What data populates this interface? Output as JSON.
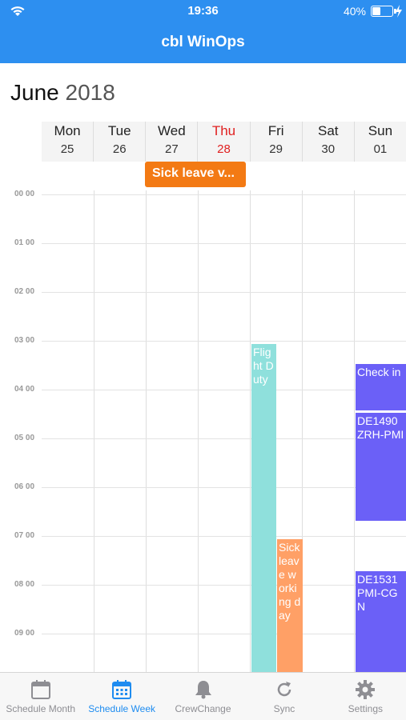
{
  "status_bar": {
    "time": "19:36",
    "battery": "40%"
  },
  "nav": {
    "title": "cbl WinOps"
  },
  "header": {
    "month": "June",
    "year": "2018"
  },
  "days": [
    {
      "name": "Mon",
      "date": "25",
      "today": false
    },
    {
      "name": "Tue",
      "date": "26",
      "today": false
    },
    {
      "name": "Wed",
      "date": "27",
      "today": false
    },
    {
      "name": "Thu",
      "date": "28",
      "today": true
    },
    {
      "name": "Fri",
      "date": "29",
      "today": false
    },
    {
      "name": "Sat",
      "date": "30",
      "today": false
    },
    {
      "name": "Sun",
      "date": "01",
      "today": false
    }
  ],
  "all_day_event": {
    "label": "Sick leave v..."
  },
  "hours": [
    "00 00",
    "01 00",
    "02 00",
    "03 00",
    "04 00",
    "05 00",
    "06 00",
    "07 00",
    "08 00",
    "09 00"
  ],
  "events": {
    "flight_duty": "Flight Duty",
    "sick_leave": "Sick leave working day",
    "check_in": "Check in",
    "de1490": "DE1490 ZRH-PMI",
    "de1531": "DE1531 PMI-CGN"
  },
  "colors": {
    "nav_bar": "#2d8ff0",
    "today": "#e02020",
    "all_day": "#f37a14",
    "flight_duty": "#8fe0dc",
    "sick_leave": "#ffa066",
    "flight": "#6b60f7",
    "tab_active": "#1e8cf0"
  },
  "tabs": [
    {
      "label": "Schedule Month",
      "icon": "calendar-icon",
      "active": false
    },
    {
      "label": "Schedule Week",
      "icon": "calendar-week-icon",
      "active": true
    },
    {
      "label": "CrewChange",
      "icon": "bell-icon",
      "active": false
    },
    {
      "label": "Sync",
      "icon": "refresh-icon",
      "active": false
    },
    {
      "label": "Settings",
      "icon": "gear-icon",
      "active": false
    }
  ]
}
